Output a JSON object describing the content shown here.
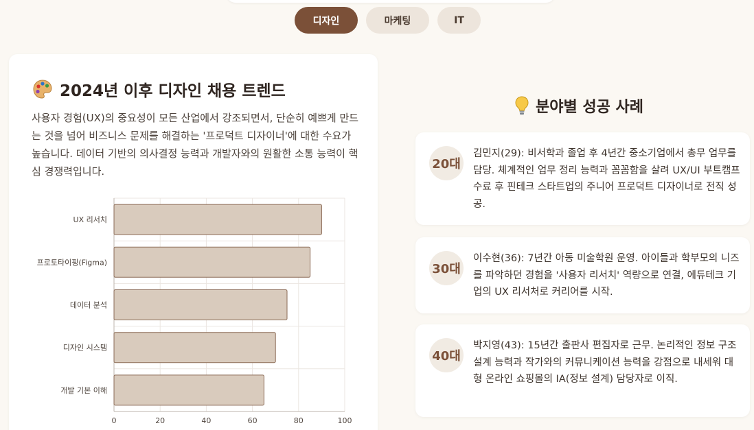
{
  "tabs": [
    {
      "label": "디자인",
      "active": true
    },
    {
      "label": "마케팅",
      "active": false
    },
    {
      "label": "IT",
      "active": false
    }
  ],
  "trend": {
    "icon": "palette-icon",
    "title": "2024년 이후 디자인 채용 트렌드",
    "description": "사용자 경험(UX)의 중요성이 모든 산업에서 강조되면서, 단순히 예쁘게 만드는 것을 넘어 비즈니스 문제를 해결하는 '프로덕트 디자이너'에 대한 수요가 높습니다. 데이터 기반의 의사결정 능력과 개발자와의 원활한 소통 능력이 핵심 경쟁력입니다."
  },
  "chart_data": {
    "type": "bar",
    "orientation": "horizontal",
    "categories": [
      "UX 리서치",
      "프로토타이핑(Figma)",
      "데이터 분석",
      "디자인 시스템",
      "개발 기본 이해"
    ],
    "values": [
      90,
      85,
      75,
      70,
      65
    ],
    "xlim": [
      0,
      100
    ],
    "xticks": [
      0,
      20,
      40,
      60,
      80,
      100
    ],
    "grid": true,
    "bar_color": "#d9cbbd",
    "bar_border": "#8a6a55"
  },
  "success": {
    "icon": "lightbulb-icon",
    "title": "분야별 성공 사례",
    "cases": [
      {
        "age": "20대",
        "text": "김민지(29): 비서학과 졸업 후 4년간 중소기업에서 총무 업무를 담당. 체계적인 업무 정리 능력과 꼼꼼함을 살려 UX/UI 부트캠프 수료 후 핀테크 스타트업의 주니어 프로덕트 디자이너로 전직 성공."
      },
      {
        "age": "30대",
        "text": "이수현(36): 7년간 아동 미술학원 운영. 아이들과 학부모의 니즈를 파악하던 경험을 '사용자 리서치' 역량으로 연결, 에듀테크 기업의 UX 리서처로 커리어를 시작."
      },
      {
        "age": "40대",
        "text": "박지영(43): 15년간 출판사 편집자로 근무. 논리적인 정보 구조 설계 능력과 작가와의 커뮤니케이션 능력을 강점으로 내세워 대형 온라인 쇼핑몰의 IA(정보 설계) 담당자로 이직."
      }
    ]
  },
  "colors": {
    "accent": "#7b5038",
    "tab_inactive": "#ede5dc",
    "background": "#fbf8f3",
    "badge_bg": "#f1ebe3"
  }
}
